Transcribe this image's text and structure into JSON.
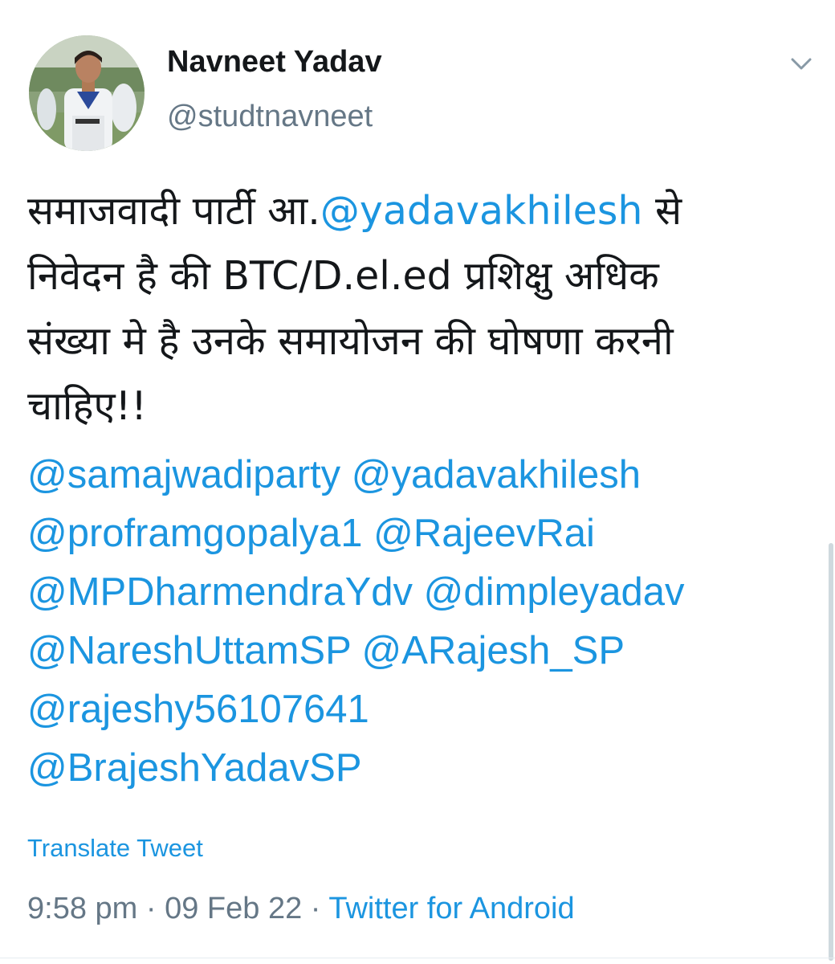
{
  "author": {
    "display_name": "Navneet Yadav",
    "handle": "@studtnavneet",
    "avatar": "profile-photo"
  },
  "tweet": {
    "text_lines": [
      [
        {
          "t": "समाजवादी पार्टी आ.",
          "m": false
        },
        {
          "t": "@yadavakhilesh",
          "m": true
        },
        {
          "t": " से",
          "m": false
        }
      ],
      [
        {
          "t": "निवेदन है की BTC/D.el.ed  प्रशिक्षु अधिक",
          "m": false
        }
      ],
      [
        {
          "t": "संख्या मे है उनके समायोजन की घोषणा करनी",
          "m": false
        }
      ],
      [
        {
          "t": "चाहिए!!",
          "m": false
        }
      ]
    ],
    "mention_lines": [
      "@samajwadiparty @yadavakhilesh",
      "@proframgopalya1 @RajeevRai",
      "@MPDharmendraYdv @dimpleyadav",
      "@NareshUttamSP @ARajesh_SP",
      "@rajeshy56107641",
      "@BrajeshYadavSP"
    ]
  },
  "translate_label": "Translate Tweet",
  "meta": {
    "time": "9:58 pm",
    "separator": " · ",
    "date": "09 Feb 22",
    "source": "Twitter for Android"
  },
  "icons": {
    "more": "chevron-down-icon"
  },
  "colors": {
    "text": "#14171a",
    "secondary": "#657786",
    "link": "#1b95e0",
    "background": "#ffffff"
  }
}
